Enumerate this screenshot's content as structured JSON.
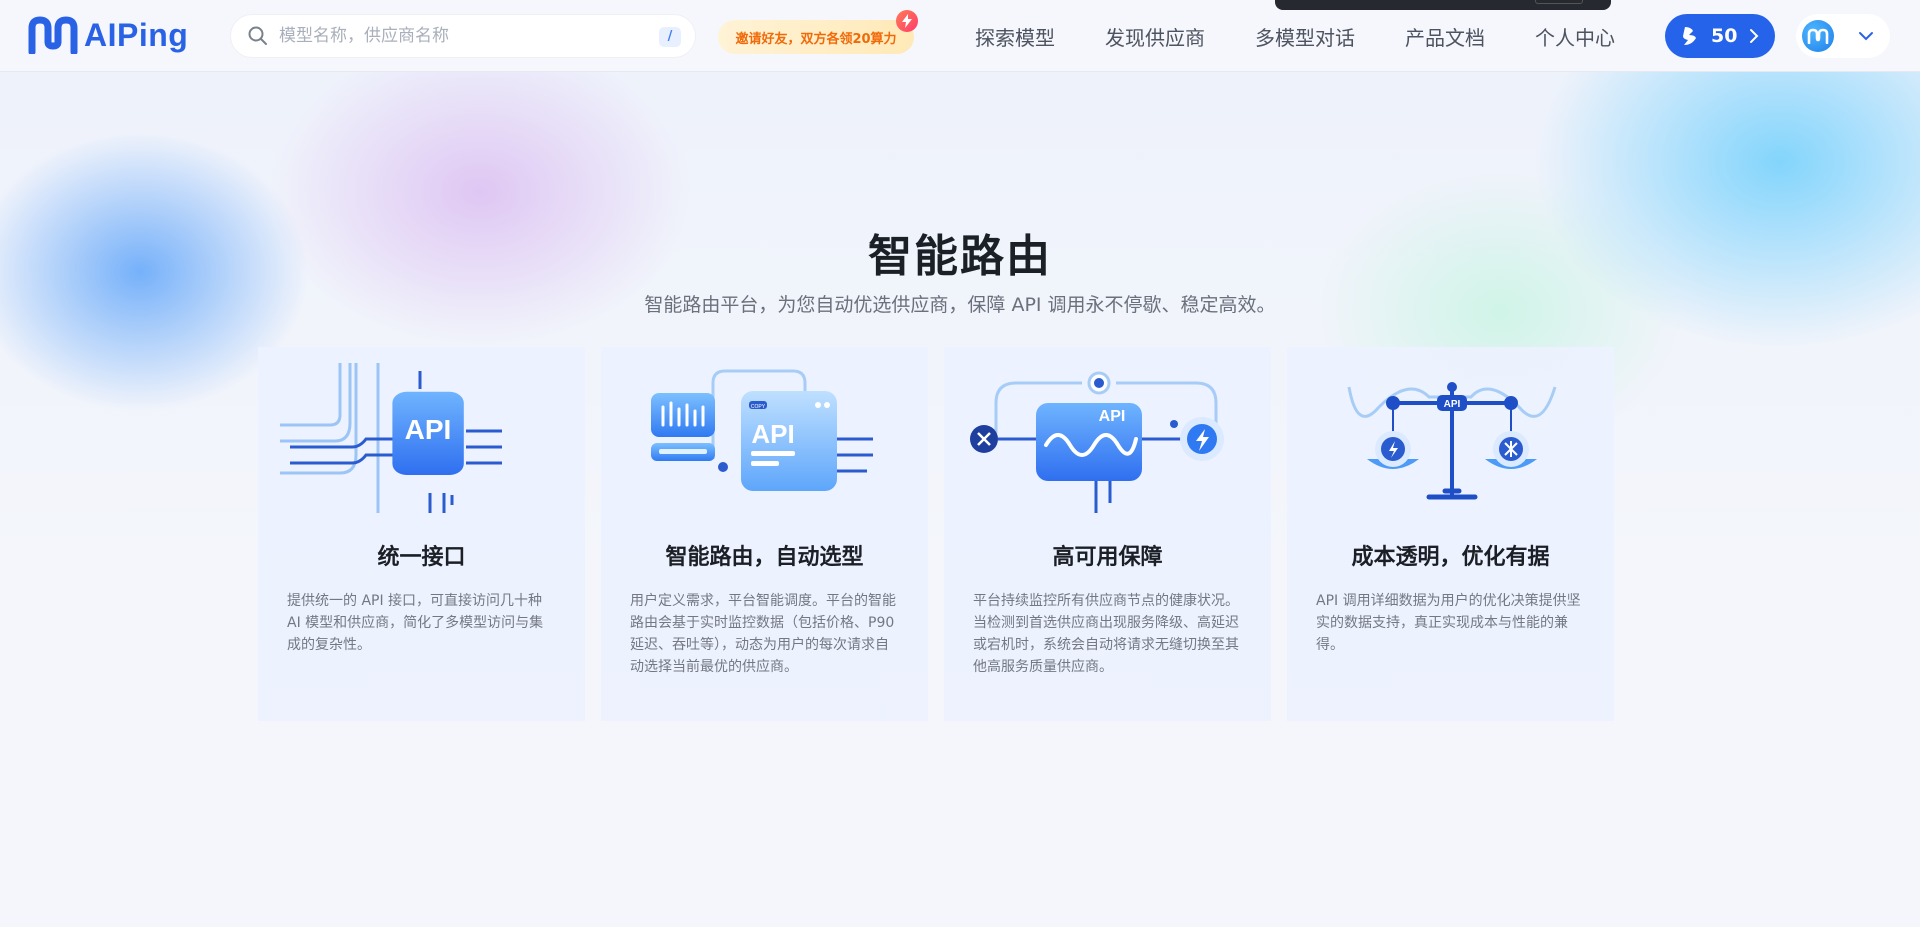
{
  "brand": {
    "name": "AIPing"
  },
  "search": {
    "placeholder": "模型名称，供应商名称",
    "shortcut": "/"
  },
  "invite": {
    "label": "邀请好友，双方各领20算力"
  },
  "nav": {
    "items": [
      {
        "label": "探索模型"
      },
      {
        "label": "发现供应商"
      },
      {
        "label": "多模型对话"
      },
      {
        "label": "产品文档"
      },
      {
        "label": "个人中心"
      }
    ]
  },
  "credits": {
    "value": "50"
  },
  "hero": {
    "title": "智能路由",
    "subtitle": "智能路由平台，为您自动优选供应商，保障 API 调用永不停歇、稳定高效。"
  },
  "cards": [
    {
      "title": "统一接口",
      "desc": "提供统一的 API 接口，可直接访问几十种 AI 模型和供应商，简化了多模型访问与集成的复杂性。",
      "icon": "api-chip-icon"
    },
    {
      "title": "智能路由，自动选型",
      "desc": "用户定义需求，平台智能调度。平台的智能路由会基于实时监控数据（包括价格、P90延迟、吞吐等），动态为用户的每次请求自动选择当前最优的供应商。",
      "icon": "api-dashboard-icon"
    },
    {
      "title": "高可用保障",
      "desc": "平台持续监控所有供应商节点的健康状况。当检测到首选供应商出现服务降级、高延迟或宕机时，系统会自动将请求无缝切换至其他高服务质量供应商。",
      "icon": "failover-icon"
    },
    {
      "title": "成本透明，优化有据",
      "desc": "API 调用详细数据为用户的优化决策提供坚实的数据支持，真正实现成本与性能的兼得。",
      "icon": "api-scale-icon"
    }
  ],
  "colors": {
    "accent": "#2563eb",
    "brand": "#2a62e6",
    "invite_text": "#f06a0a"
  }
}
